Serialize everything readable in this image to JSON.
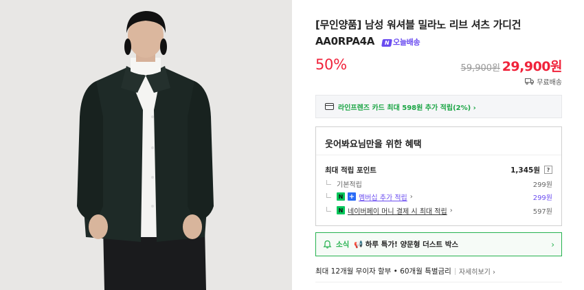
{
  "product": {
    "title": "[무인양품] 남성 워셔블 밀라노 리브 셔츠 가디건 AA0RPA4A",
    "delivery_badge_mark": "N",
    "delivery_badge": "오늘배송",
    "discount": "50%",
    "original_price": "59,900원",
    "sale_price": "29,900원",
    "shipping": "무료배송"
  },
  "card_banner": {
    "text": "라인프렌즈 카드 최대 598원 추가 적립(2%) ›"
  },
  "benefits": {
    "title": "웃어봐요님만을 위한 혜택",
    "max_points_label": "최대 적립 포인트",
    "max_points_value": "1,345원",
    "help": "?",
    "basic_label": "기본적립",
    "basic_value": "299원",
    "membership_n": "N",
    "membership_plus": "+",
    "membership_label": "멤버십 추가 적립",
    "membership_value": "299원",
    "npay_n": "N",
    "npay_label": "네이버페이 머니 결제 시 최대 적립",
    "npay_value": "597원"
  },
  "news": {
    "prefix": "소식",
    "text": "하루 특가! 양문형 더스트 박스"
  },
  "installment": {
    "text": "최대 12개월 무이자 할부 • 60개월 특별금리",
    "detail": "자세히보기 ›"
  },
  "colors": {
    "accent_red": "#f0233b",
    "naver_green": "#03c75a",
    "delivery_purple": "#6a4cf0"
  }
}
